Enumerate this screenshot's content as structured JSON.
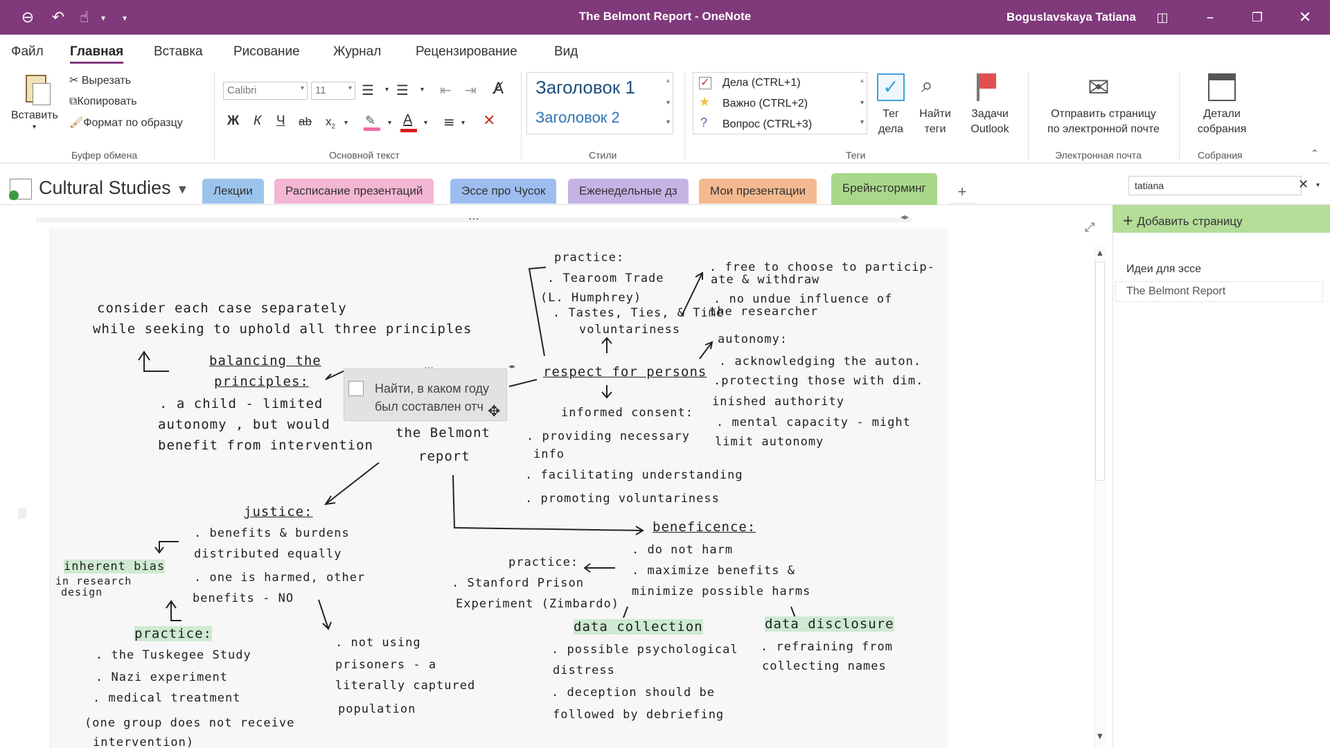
{
  "window": {
    "title": "The Belmont Report  -  OneNote",
    "user": "Boguslavskaya Tatiana"
  },
  "menu": [
    "Файл",
    "Главная",
    "Вставка",
    "Рисование",
    "Журнал",
    "Рецензирование",
    "Вид"
  ],
  "ribbon": {
    "clipboard": {
      "paste": "Вставить",
      "cut": "Вырезать",
      "copy": "Копировать",
      "format": "Формат по образцу",
      "label": "Буфер обмена"
    },
    "text": {
      "font": "Calibri",
      "size": "11",
      "bold": "Ж",
      "italic": "К",
      "underline": "Ч",
      "strike": "ab",
      "sub": "x",
      "label": "Основной текст"
    },
    "styles": {
      "h1": "Заголовок 1",
      "h2": "Заголовок 2",
      "label": "Стили"
    },
    "tags": {
      "todo": "Дела (CTRL+1)",
      "important": "Важно (CTRL+2)",
      "question": "Вопрос (CTRL+3)",
      "label": "Теги",
      "tag_btn": "Тег\nдела",
      "find_btn": "Найти\nтеги",
      "outlook_btn": "Задачи\nOutlook"
    },
    "email": {
      "btn": "Отправить страницу\nпо электронной почте",
      "label": "Электронная почта"
    },
    "meetings": {
      "btn": "Детали\nсобрания",
      "label": "Собрания"
    }
  },
  "notebook": {
    "name": "Cultural Studies"
  },
  "sections": [
    {
      "label": "Лекции",
      "color": "#9bc4ec"
    },
    {
      "label": "Расписание презентаций",
      "color": "#f3b6d3"
    },
    {
      "label": "Эссе про Чусок",
      "color": "#9dbdf0"
    },
    {
      "label": "Еженедельные дз",
      "color": "#c6b3e6"
    },
    {
      "label": "Мои презентации",
      "color": "#f4b98f"
    },
    {
      "label": "Брейнсторминг",
      "color": "#a9d88a"
    }
  ],
  "search": {
    "value": "tatiana"
  },
  "pages": {
    "add": "Добавить страницу",
    "items": [
      "Идеи для эссе",
      "The Belmont Report"
    ]
  },
  "popup": {
    "text1": "Найти, в каком году",
    "text2": "был составлен отч"
  },
  "handwriting": {
    "center1": "the Belmont",
    "center2": "report",
    "consider1": "consider each case separately",
    "consider2": "while seeking to uphold all three principles",
    "bal1": "balancing the",
    "bal2": "principles:",
    "bal3": ". a child - limited",
    "bal4": "autonomy , but would",
    "bal5": "benefit from intervention",
    "prac1": "practice:",
    "prac2": ". Tearoom Trade",
    "prac3": "(L. Humphrey)",
    "prac4": ". Tastes, Ties, & Time",
    "prac5": "voluntariness",
    "free1": ". free to choose to particip-",
    "free2": "ate & withdraw",
    "free3": ". no undue influence of",
    "free4": "the researcher",
    "rfp": "respect for persons",
    "aut1": "autonomy:",
    "aut2": ". acknowledging the auton.",
    "aut3": ".protecting those with dim.",
    "aut4": "inished authority",
    "aut5": ". mental capacity - might",
    "aut6": "limit autonomy",
    "ic": "informed consent:",
    "ic1": ". providing necessary",
    "ic2": "info",
    "ic3": ". facilitating understanding",
    "ic4": ". promoting voluntariness",
    "jus": "justice:",
    "jus1": ". benefits & burdens",
    "jus2": "distributed equally",
    "jus3": ". one is harmed, other",
    "jus4": "benefits - NO",
    "ib1": "inherent bias",
    "ib2": "in research",
    "ib3": "design",
    "pj": "practice:",
    "pj1": ". the Tuskegee Study",
    "pj2": ". Nazi experiment",
    "pj3": ". medical treatment",
    "pj4": "(one group does not receive",
    "pj5": "intervention)",
    "np1": ". not using",
    "np2": "prisoners - a",
    "np3": "literally captured",
    "np4": "population",
    "ben": "beneficence:",
    "ben1": ". do not harm",
    "ben2": ". maximize benefits &",
    "ben3": "minimize possible harms",
    "pb": "practice:",
    "pb1": ". Stanford Prison",
    "pb2": "Experiment (Zimbardo)",
    "dc": "data collection",
    "dc1": ". possible psychological",
    "dc2": "distress",
    "dc3": ". deception should be",
    "dc4": "followed by debriefing",
    "dd": "data disclosure",
    "dd1": ". refraining from",
    "dd2": "collecting names"
  }
}
